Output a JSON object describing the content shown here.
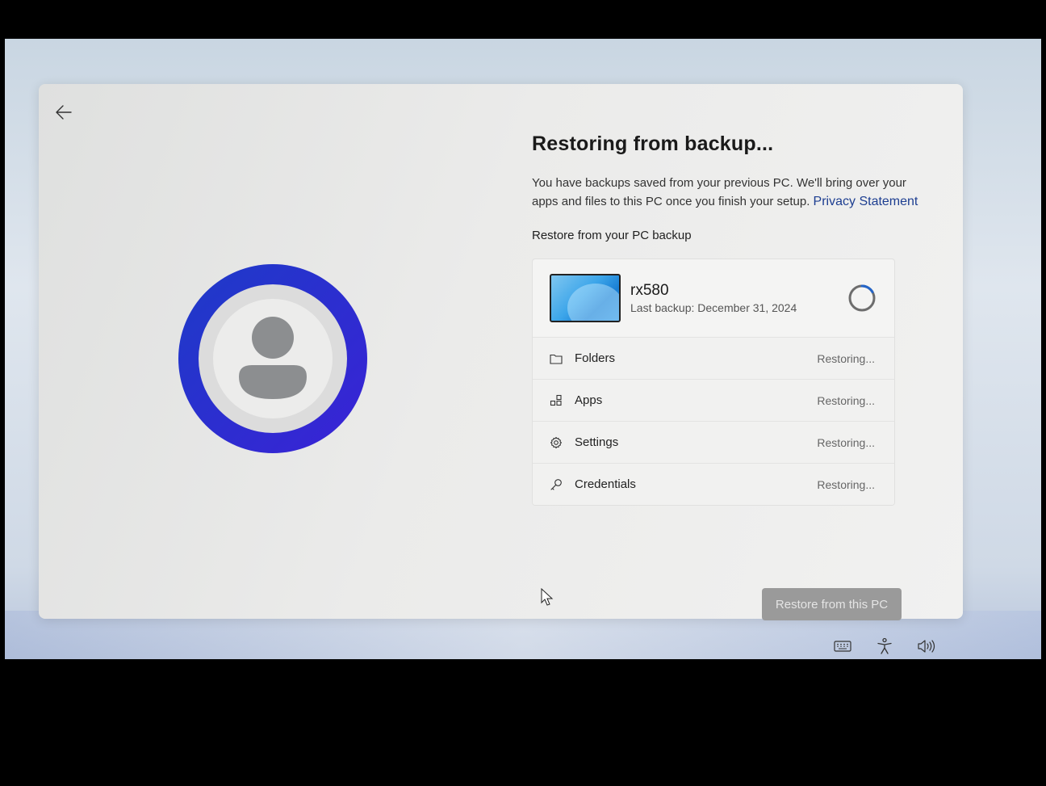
{
  "page": {
    "title": "Restoring from backup...",
    "description": "You have backups saved from your previous PC. We'll bring over your apps and files to this PC once you finish your setup.",
    "privacy_link": "Privacy Statement",
    "section_label": "Restore from your PC backup"
  },
  "device": {
    "name": "rx580",
    "last_backup": "Last backup: December 31, 2024"
  },
  "items": [
    {
      "label": "Folders",
      "status": "Restoring...",
      "icon": "folder-icon"
    },
    {
      "label": "Apps",
      "status": "Restoring...",
      "icon": "apps-icon"
    },
    {
      "label": "Settings",
      "status": "Restoring...",
      "icon": "gear-icon"
    },
    {
      "label": "Credentials",
      "status": "Restoring...",
      "icon": "key-icon"
    }
  ],
  "actions": {
    "restore_label": "Restore from this PC"
  },
  "colors": {
    "avatar_ring": "#2b2fcf",
    "link": "#1d3e91",
    "button_disabled": "#9a9a9a"
  }
}
